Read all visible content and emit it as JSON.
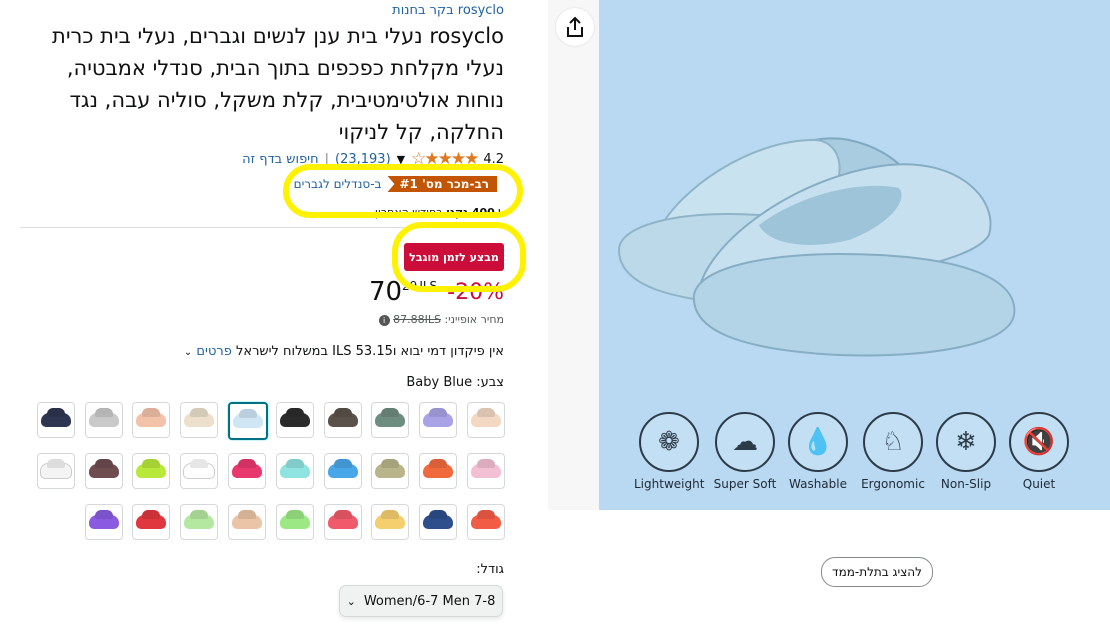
{
  "product": {
    "brand_link": "בקר בחנות rosyclo",
    "title": "rosyclo נעלי בית ענן לנשים וגברים, נעלי בית כרית נעלי מקלחת כפכפים בתוך הבית, סנדלי אמבטיה, נוחות אולטימטיבית, קלת משקל, סוליה עבה, נגד החלקה, קל לניקוי",
    "rating_value": "4.2",
    "rating_count": "(23,193)",
    "search_link": "חיפוש בדף זה",
    "bestseller_badge": "רב-מכר מס' #1",
    "bestseller_category": "ב-סנדלים לגברים",
    "bought_bold": "+400 נקנו",
    "bought_rest": " בחודש האחרון",
    "deal_badge": "מבצע לזמן מוגבל",
    "discount": "-20%",
    "price_whole": "70",
    "price_fraction": "29",
    "price_currency": "ILS",
    "list_price_label": "מחיר אופייני:",
    "list_price": "87.88ILS",
    "shipping_text": "אין פיקדון דמי יבוא ו53.15 ILS במשלוח לישראל",
    "shipping_link": "פרטים",
    "color_label": "צבע:",
    "color_value": "Baby Blue",
    "size_label": "גודל:",
    "size_value": "Women/6-7 Men 7-8"
  },
  "gallery": {
    "view_3d": "להציג בתלת-ממד",
    "features": [
      {
        "label": "Lightweight",
        "icon": "feather-icon"
      },
      {
        "label": "Super Soft",
        "icon": "cloud-icon"
      },
      {
        "label": "Washable",
        "icon": "drops-icon"
      },
      {
        "label": "Ergonomic",
        "icon": "footprint-icon"
      },
      {
        "label": "Non-Slip",
        "icon": "slip-icon"
      },
      {
        "label": "Quiet",
        "icon": "mute-icon"
      }
    ]
  },
  "colors": {
    "selected": "#cfe6f5",
    "row1": [
      "#f3d8c4",
      "#a9a2e6",
      "#6f8c80",
      "#5a524a",
      "#2b2b2b",
      "#cfe6f5",
      "#ece0cc",
      "#f3c2a8",
      "#c9c9c9",
      "#2e3550"
    ],
    "row2": [
      "#f2bfd3",
      "#f06a3d",
      "#b9b58a",
      "#49a6e8",
      "#8fe3e0",
      "#e8386e",
      "#ffffff",
      "#b8e83a",
      "#6e4c50",
      "#f4f4f4"
    ],
    "row3": [
      "#f25c45",
      "#2e4f8c",
      "#f5cf6e",
      "#f05a6a",
      "#9be884",
      "#ebc3a6",
      "#b4e8a0",
      "#e0363e",
      "#8a5be0"
    ]
  }
}
